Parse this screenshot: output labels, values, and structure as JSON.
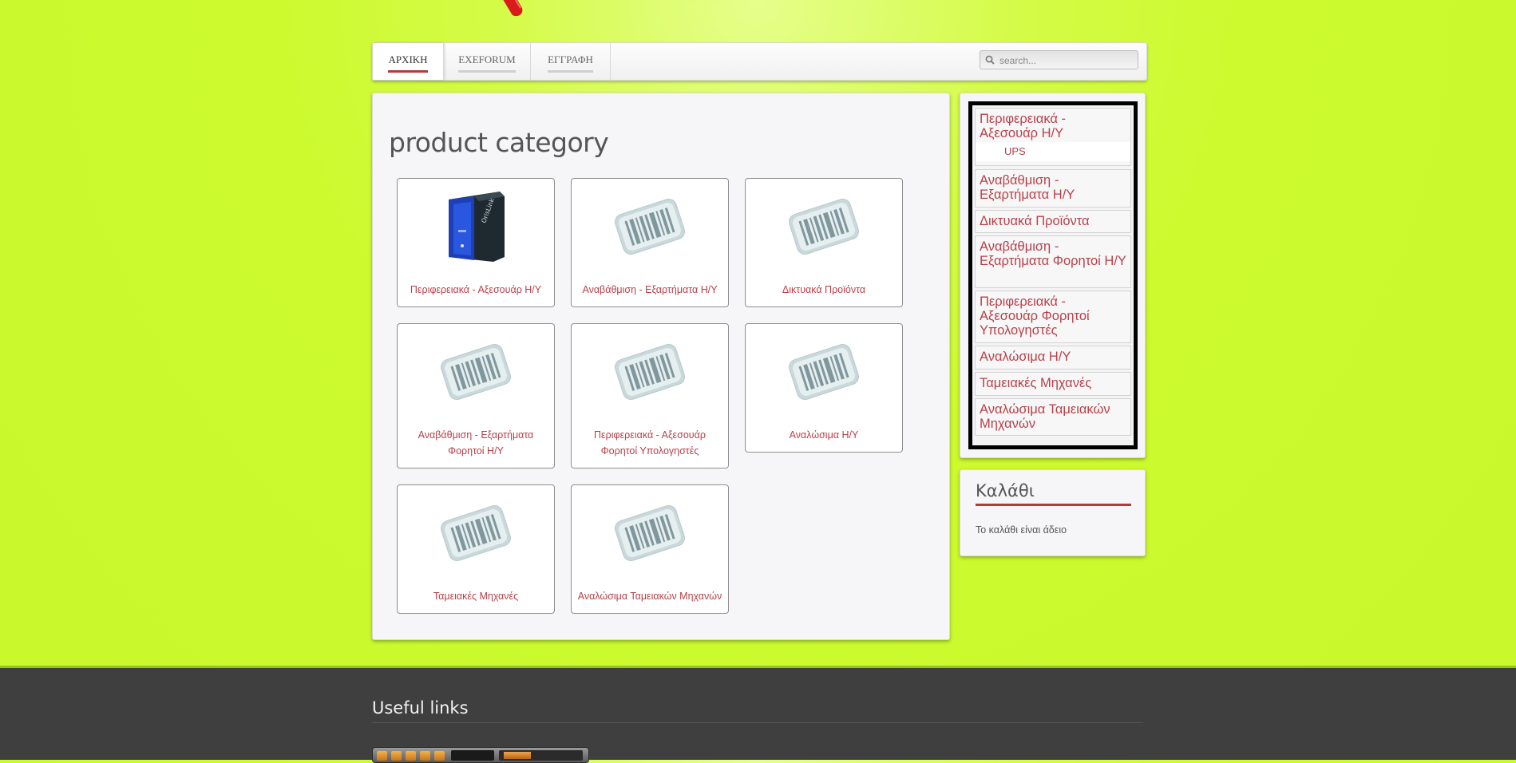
{
  "nav": {
    "tabs": [
      {
        "label": "ΑΡΧΙΚΗ",
        "active": true
      },
      {
        "label": "EXEFORUM",
        "active": false
      },
      {
        "label": "ΕΓΓΡΑΦΗ",
        "active": false
      }
    ],
    "search_placeholder": "search..."
  },
  "main": {
    "title": "product category",
    "categories": [
      {
        "label": "Περιφερειακά - Αξεσουάρ Η/Υ",
        "icon": "ups-product-icon"
      },
      {
        "label": "Αναβάθμιση - Εξαρτήματα Η/Υ",
        "icon": "barcode-icon"
      },
      {
        "label": "Δικτυακά Προϊόντα",
        "icon": "barcode-icon"
      },
      {
        "label": "Αναβάθμιση - Εξαρτήματα Φορητοί Η/Υ",
        "icon": "barcode-icon"
      },
      {
        "label": "Περιφερειακά - Αξεσουάρ Φορητοί Υπολογηστές",
        "icon": "barcode-icon"
      },
      {
        "label": "Αναλώσιμα Η/Υ",
        "icon": "barcode-icon"
      },
      {
        "label": "Ταμειακές Μηχανές",
        "icon": "barcode-icon"
      },
      {
        "label": "Αναλώσιμα Ταμειακών Μηχανών",
        "icon": "barcode-icon"
      }
    ]
  },
  "sidebar": {
    "items": [
      {
        "label": "Περιφερειακά - Αξεσουάρ Η/Υ"
      },
      {
        "label": "Αναβάθμιση - Εξαρτήματα Η/Υ"
      },
      {
        "label": "Δικτυακά Προϊόντα"
      },
      {
        "label": "Αναβάθμιση - Εξαρτήματα Φορητοί Η/Υ"
      },
      {
        "label": "Περιφερειακά - Αξεσουάρ Φορητοί Υπολογηστές"
      },
      {
        "label": "Αναλώσιμα Η/Υ"
      },
      {
        "label": "Ταμειακές Μηχανές"
      },
      {
        "label": "Αναλώσιμα Ταμειακών Μηχανών"
      }
    ],
    "sub_item": "UPS"
  },
  "cart": {
    "title": "Καλάθι",
    "empty_text": "Το καλάθι είναι άδειο"
  },
  "footer": {
    "title": "Useful links"
  },
  "colors": {
    "link": "#b8404a",
    "accent": "#b23a3a",
    "background": "#ccfa2e",
    "footer": "#3f3f3f"
  }
}
